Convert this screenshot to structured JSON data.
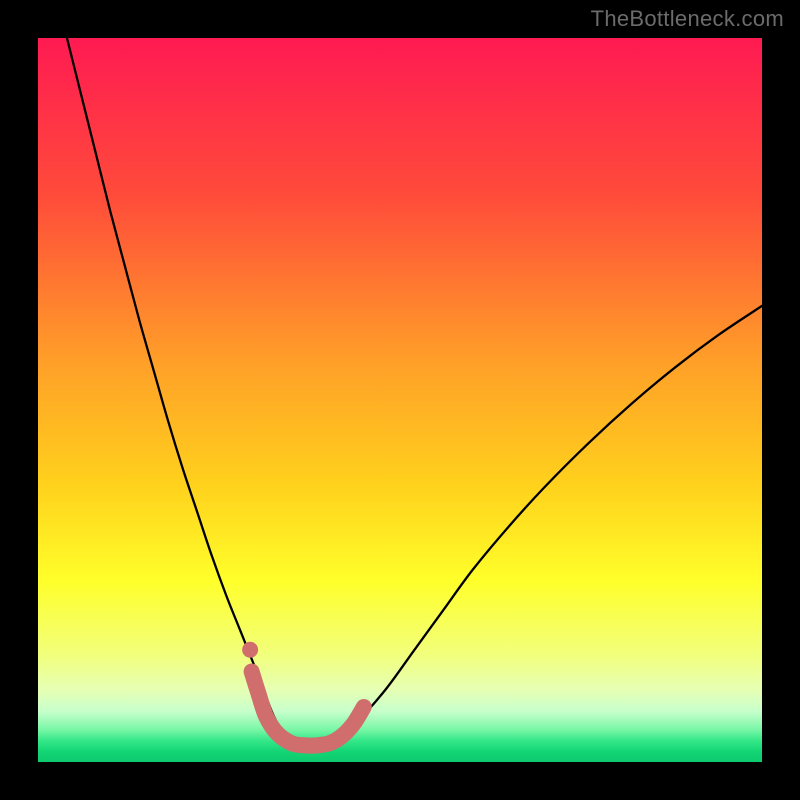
{
  "watermark": "TheBottleneck.com",
  "chart_data": {
    "type": "line",
    "title": "",
    "xlabel": "",
    "ylabel": "",
    "xlim": [
      0,
      100
    ],
    "ylim": [
      0,
      100
    ],
    "gradient_stops": [
      {
        "offset": 0,
        "color": "#ff1a52"
      },
      {
        "offset": 0.22,
        "color": "#ff4c3a"
      },
      {
        "offset": 0.45,
        "color": "#ffa028"
      },
      {
        "offset": 0.62,
        "color": "#ffd21c"
      },
      {
        "offset": 0.75,
        "color": "#ffff2a"
      },
      {
        "offset": 0.85,
        "color": "#f2ff7a"
      },
      {
        "offset": 0.9,
        "color": "#e6ffb3"
      },
      {
        "offset": 0.93,
        "color": "#c8ffcc"
      },
      {
        "offset": 0.955,
        "color": "#7af7a7"
      },
      {
        "offset": 0.97,
        "color": "#36e889"
      },
      {
        "offset": 0.985,
        "color": "#14d676"
      },
      {
        "offset": 1.0,
        "color": "#0cc96e"
      }
    ],
    "series": [
      {
        "name": "bottleneck-curve",
        "x": [
          4,
          6,
          8,
          10,
          12,
          14,
          16,
          18,
          20,
          22,
          24,
          26,
          28,
          30,
          31.5,
          33,
          35,
          37,
          39,
          41,
          44,
          48,
          52,
          56,
          60,
          65,
          70,
          76,
          82,
          88,
          94,
          100
        ],
        "y": [
          100,
          92,
          84,
          76,
          68.5,
          61,
          54,
          47,
          40.5,
          34.5,
          28.5,
          23,
          18,
          13,
          9,
          5.5,
          3.2,
          2.5,
          2.5,
          3.2,
          5.5,
          10,
          15.5,
          21,
          26.5,
          32.5,
          38,
          44,
          49.5,
          54.5,
          59,
          63
        ],
        "color": "#000000",
        "stroke_width": 2.3
      },
      {
        "name": "highlight-band",
        "x": [
          29.5,
          30.5,
          31.5,
          33,
          35,
          36.8,
          38.5,
          40.3,
          42,
          43.6,
          45
        ],
        "y": [
          12.5,
          9.3,
          6.3,
          4.0,
          2.6,
          2.3,
          2.3,
          2.6,
          3.6,
          5.3,
          7.6
        ],
        "color": "#cf6e6c",
        "stroke_width": 16
      },
      {
        "name": "highlight-dot",
        "type": "scatter",
        "x": [
          29.3
        ],
        "y": [
          15.5
        ],
        "color": "#cf6e6c",
        "r": 8
      }
    ]
  }
}
